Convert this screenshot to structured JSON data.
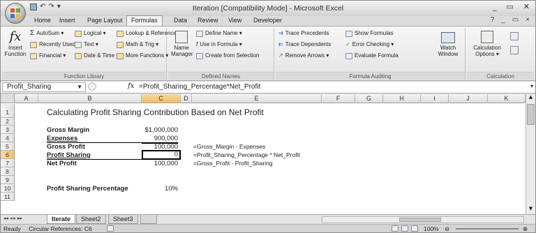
{
  "window": {
    "title": "Iteration  [Compatibility Mode] - Microsoft Excel",
    "controls": [
      "_",
      "▭",
      "✕"
    ]
  },
  "quick_access": [
    "▾"
  ],
  "tabs": [
    "Home",
    "Insert",
    "Page Layout",
    "Formulas",
    "Data",
    "Review",
    "View",
    "Developer"
  ],
  "tab_active": "Formulas",
  "ribbon": {
    "function_library": {
      "label": "Function Library",
      "insert_function": "Insert Function",
      "autosum": "AutoSum ▾",
      "recently_used": "Recently Used ▾",
      "financial": "Financial ▾",
      "logical": "Logical ▾",
      "text": "Text ▾",
      "date_time": "Date & Time ▾",
      "lookup": "Lookup & Reference ▾",
      "math": "Math & Trig ▾",
      "more": "More Functions ▾"
    },
    "defined_names": {
      "label": "Defined Names",
      "name_manager": "Name Manager",
      "define_name": "Define Name ▾",
      "use_in_formula": "Use in Formula ▾",
      "create_from_selection": "Create from Selection"
    },
    "formula_auditing": {
      "label": "Formula Auditing",
      "trace_precedents": "Trace Precedents",
      "trace_dependents": "Trace Dependents",
      "remove_arrows": "Remove Arrows ▾",
      "show_formulas": "Show Formulas",
      "error_checking": "Error Checking ▾",
      "evaluate_formula": "Evaluate Formula",
      "watch_window": "Watch Window"
    },
    "calculation": {
      "label": "Calculation",
      "calculation_options": "Calculation Options ▾"
    }
  },
  "formula_bar": {
    "name_box": "Profit_Sharing",
    "fx": "fx",
    "formula": "=Profit_Sharing_Percentage*Net_Profit"
  },
  "columns": [
    "A",
    "B",
    "C",
    "D",
    "E",
    "F",
    "G",
    "H",
    "I",
    "J",
    "K"
  ],
  "rows": [
    "1",
    "2",
    "3",
    "4",
    "5",
    "6",
    "7",
    "8",
    "9",
    "10",
    "11"
  ],
  "sheet": {
    "title": "Calculating Profit Sharing Contribution Based on Net Profit",
    "gross_margin_label": "Gross Margin",
    "gross_margin_value": "$1,000,000",
    "expenses_label": "Expenses",
    "expenses_value": "900,000",
    "gross_profit_label": "Gross Profit",
    "gross_profit_value": "100,000",
    "gross_profit_formula": "=Gross_Margin - Expenses",
    "profit_sharing_label": "Profit Sharing",
    "profit_sharing_value": "0",
    "profit_sharing_formula": "=Profit_Sharing_Percentage * Net_Profit",
    "net_profit_label": "Net Profit",
    "net_profit_value": "100,000",
    "net_profit_formula": "=Gross_Profit - Profit_Sharing",
    "psp_label": "Profit Sharing Percentage",
    "psp_value": "10%"
  },
  "sheet_tabs": [
    "Iterate",
    "Sheet2",
    "Sheet3"
  ],
  "sheet_nav": "◂◂ ◂ ▸ ▸▸",
  "status": {
    "ready": "Ready",
    "circular": "Circular References: C6",
    "zoom": "100%"
  }
}
